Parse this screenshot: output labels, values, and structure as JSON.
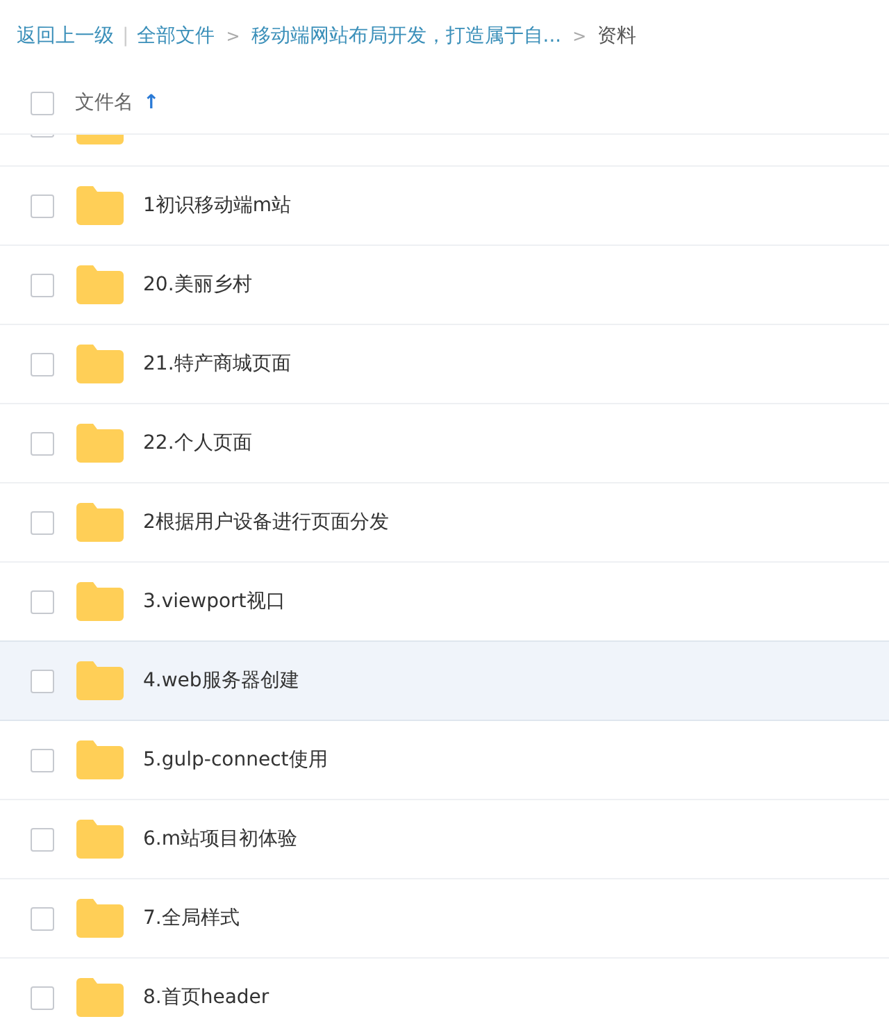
{
  "breadcrumb": {
    "back": "返回上一级",
    "separator": "|",
    "items": [
      {
        "label": "全部文件",
        "current": false
      },
      {
        "label": "移动端网站布局开发，打造属于自...",
        "current": false
      },
      {
        "label": "资料",
        "current": true
      }
    ],
    "arrow": ">"
  },
  "header": {
    "checked": false,
    "column": "文件名",
    "sort": "↑"
  },
  "rows": [
    {
      "kind": "clipped",
      "checked": false
    },
    {
      "kind": "folder",
      "name": "1初识移动端m站",
      "checked": false,
      "highlighted": false
    },
    {
      "kind": "folder",
      "name": "20.美丽乡村",
      "checked": false,
      "highlighted": false
    },
    {
      "kind": "folder",
      "name": "21.特产商城页面",
      "checked": false,
      "highlighted": false
    },
    {
      "kind": "folder",
      "name": "22.个人页面",
      "checked": false,
      "highlighted": false
    },
    {
      "kind": "folder",
      "name": "2根据用户设备进行页面分发",
      "checked": false,
      "highlighted": false
    },
    {
      "kind": "folder",
      "name": "3.viewport视口",
      "checked": false,
      "highlighted": false
    },
    {
      "kind": "folder",
      "name": "4.web服务器创建",
      "checked": false,
      "highlighted": true
    },
    {
      "kind": "folder",
      "name": "5.gulp-connect使用",
      "checked": false,
      "highlighted": false
    },
    {
      "kind": "folder",
      "name": "6.m站项目初体验",
      "checked": false,
      "highlighted": false
    },
    {
      "kind": "folder",
      "name": "7.全局样式",
      "checked": false,
      "highlighted": false
    },
    {
      "kind": "folder",
      "name": "8.首页header",
      "checked": false,
      "highlighted": false
    }
  ]
}
